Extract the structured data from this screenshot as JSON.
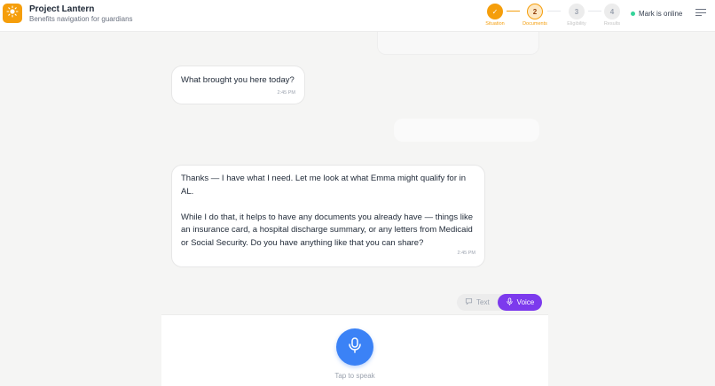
{
  "app": {
    "title": "Project Lantern",
    "subtitle": "Benefits navigation for guardians",
    "brand_color": "#f59e0b"
  },
  "steps": [
    {
      "number": "✓",
      "label": "Situation",
      "state": "done"
    },
    {
      "number": "2",
      "label": "Documents",
      "state": "active"
    },
    {
      "number": "3",
      "label": "Eligibility",
      "state": "todo"
    },
    {
      "number": "4",
      "label": "Results",
      "state": "todo"
    }
  ],
  "status": {
    "text": "Mark is online",
    "color": "#34d399"
  },
  "messages": [
    {
      "text": "What brought you here today?",
      "time": "2:45 PM"
    },
    {
      "text": "Thanks — I have what I need. Let me look at what Emma might qualify for in AL.\n\nWhile I do that, it helps to have any documents you already have — things like an insurance card, a hospital discharge summary, or any letters from Medicaid or Social Security. Do you have anything like that you can share?",
      "time": "2:45 PM"
    }
  ],
  "mode_toggle": {
    "text_label": "Text",
    "voice_label": "Voice",
    "selected": "Voice",
    "voice_color": "#7c3aed"
  },
  "voice": {
    "prompt": "Tap to speak",
    "mic_color": "#3b82f6"
  },
  "icons": {
    "logo": "sun-icon",
    "menu": "hamburger-icon",
    "text_mode": "chat-bubble-icon",
    "voice_mode": "microphone-icon"
  }
}
